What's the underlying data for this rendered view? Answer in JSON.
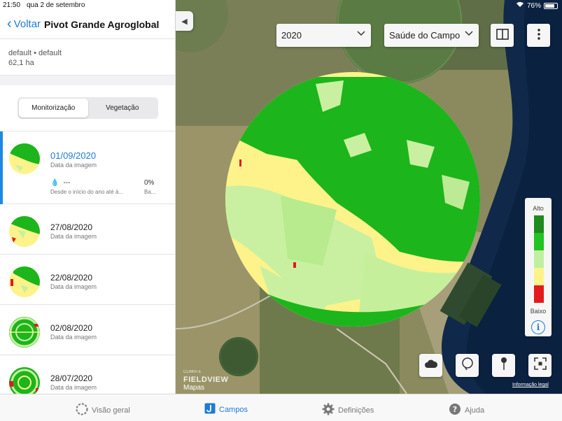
{
  "status": {
    "time": "21:50",
    "date": "qua 2 de setembro",
    "battery": "76%"
  },
  "nav": {
    "back_label": "Voltar",
    "title": "Pivot Grande Agroglobal"
  },
  "field": {
    "line1": "default • default",
    "area": "62,1 ha"
  },
  "segment": {
    "options": [
      "Monitorização",
      "Vegetação"
    ],
    "selected": "Monitorização"
  },
  "images": [
    {
      "date": "01/09/2020",
      "sub": "Data da imagem",
      "rain": "---",
      "rain_sub": "Desde o início do ano até à...",
      "pct": "0%",
      "pct_sub": "Ba..."
    },
    {
      "date": "27/08/2020",
      "sub": "Data da imagem"
    },
    {
      "date": "22/08/2020",
      "sub": "Data da imagem"
    },
    {
      "date": "02/08/2020",
      "sub": "Data da imagem"
    },
    {
      "date": "28/07/2020",
      "sub": "Data da imagem"
    }
  ],
  "map": {
    "year": "2020",
    "layer": "Saúde do Campo",
    "legend": {
      "high": "Alto",
      "low": "Baixo"
    },
    "legend_colors": [
      "#1f8a1f",
      "#22c322",
      "#bff0a0",
      "#fdf38a",
      "#e31a1c"
    ],
    "legal": "Informação legal",
    "maps_label": "Mapas",
    "brand": "FIELDVIEW",
    "brand_prefix": "CLIMATE"
  },
  "tabs": [
    {
      "label": "Visão geral",
      "icon": "spinner-icon",
      "active": false
    },
    {
      "label": "Campos",
      "icon": "fields-icon",
      "active": true
    },
    {
      "label": "Definições",
      "icon": "gear-icon",
      "active": false
    },
    {
      "label": "Ajuda",
      "icon": "help-icon",
      "active": false
    }
  ]
}
